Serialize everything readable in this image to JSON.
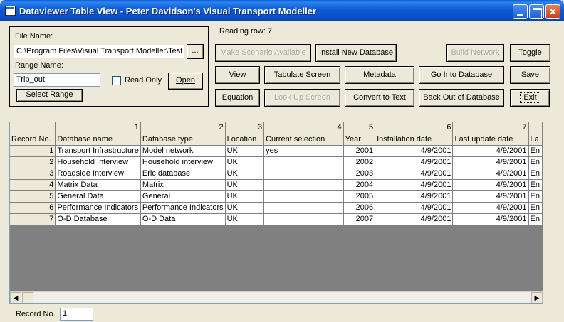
{
  "window": {
    "title": "Dataviewer Table View - Peter Davidson's Visual Transport Modeller",
    "min_glyph": "",
    "max_glyph": "",
    "close_glyph": "✕"
  },
  "file": {
    "file_name_label": "File Name:",
    "file_name_value": "C:\\Program Files\\Visual Transport Modeller\\Test",
    "browse_label": "...",
    "range_name_label": "Range Name:",
    "range_name_value": "Trip_out",
    "read_only_label": "Read Only",
    "open_label": "Open",
    "select_range_label": "Select Range"
  },
  "status": {
    "reading_row": "Reading row:  7"
  },
  "buttons": {
    "make_scenario": "Make Scenario Available",
    "install_db": "Install New Database",
    "build_network": "Build Network",
    "toggle": "Toggle",
    "view": "View",
    "tabulate": "Tabulate Screen",
    "metadata": "Metadata",
    "go_into_db": "Go Into Database",
    "save": "Save",
    "equation": "Equation",
    "look_up": "Look Up Screen",
    "convert": "Convert to Text",
    "back_out": "Back Out of Database",
    "exit": "Exit"
  },
  "grid": {
    "column_numbers": [
      "",
      "1",
      "2",
      "3",
      "4",
      "5",
      "6",
      "7",
      ""
    ],
    "headers": [
      "Record No.",
      "Database name",
      "Database type",
      "Location",
      "Current selection",
      "Year",
      "Installation date",
      "Last update date",
      "La"
    ],
    "rows": [
      [
        "1",
        "Transport Infrastructure",
        "Model network",
        "UK",
        "yes",
        "2001",
        "4/9/2001",
        "4/9/2001",
        "En"
      ],
      [
        "2",
        "Household Interview",
        "Household interview",
        "UK",
        "",
        "2002",
        "4/9/2001",
        "4/9/2001",
        "En"
      ],
      [
        "3",
        "Roadside Interview",
        "Eric database",
        "UK",
        "",
        "2003",
        "4/9/2001",
        "4/9/2001",
        "En"
      ],
      [
        "4",
        "Matrix Data",
        "Matrix",
        "UK",
        "",
        "2004",
        "4/9/2001",
        "4/9/2001",
        "En"
      ],
      [
        "5",
        "General Data",
        "General",
        "UK",
        "",
        "2005",
        "4/9/2001",
        "4/9/2001",
        "En"
      ],
      [
        "6",
        "Performance Indicators",
        "Performance Indicators",
        "UK",
        "",
        "2006",
        "4/9/2001",
        "4/9/2001",
        "En"
      ],
      [
        "7",
        "O-D Database",
        "O-D Data",
        "UK",
        "",
        "2007",
        "4/9/2001",
        "4/9/2001",
        "En"
      ]
    ],
    "scroll_left": "◀",
    "scroll_right": "▶"
  },
  "footer": {
    "record_no_label": "Record No.",
    "record_no_value": "1"
  }
}
